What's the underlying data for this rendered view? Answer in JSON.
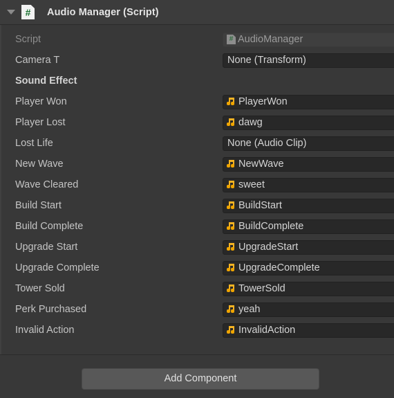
{
  "component": {
    "title": "Audio Manager (Script)",
    "foldout_icon": "chevron-down-icon",
    "script_icon": "script-file-icon",
    "script_icon_glyph": "#"
  },
  "fields": [
    {
      "label": "Script",
      "value": "AudioManager",
      "icon": "script-file-icon",
      "icon_glyph": "#",
      "disabled": true
    },
    {
      "label": "Camera T",
      "value": "None (Transform)",
      "icon": null,
      "disabled": false
    }
  ],
  "sections": [
    {
      "header": "Sound Effect",
      "fields": [
        {
          "label": "Player Won",
          "value": "PlayerWon",
          "icon": "audio-clip-icon"
        },
        {
          "label": "Player Lost",
          "value": "dawg",
          "icon": "audio-clip-icon"
        },
        {
          "label": "Lost Life",
          "value": "None (Audio Clip)",
          "icon": null
        },
        {
          "label": "New Wave",
          "value": "NewWave",
          "icon": "audio-clip-icon"
        },
        {
          "label": "Wave Cleared",
          "value": "sweet",
          "icon": "audio-clip-icon"
        },
        {
          "label": "Build Start",
          "value": "BuildStart",
          "icon": "audio-clip-icon"
        },
        {
          "label": "Build Complete",
          "value": "BuildComplete",
          "icon": "audio-clip-icon"
        },
        {
          "label": "Upgrade Start",
          "value": "UpgradeStart",
          "icon": "audio-clip-icon"
        },
        {
          "label": "Upgrade Complete",
          "value": "UpgradeComplete",
          "icon": "audio-clip-icon"
        },
        {
          "label": "Tower Sold",
          "value": "TowerSold",
          "icon": "audio-clip-icon"
        },
        {
          "label": "Perk Purchased",
          "value": "yeah",
          "icon": "audio-clip-icon"
        },
        {
          "label": "Invalid Action",
          "value": "InvalidAction",
          "icon": "audio-clip-icon"
        }
      ]
    }
  ],
  "footer": {
    "add_component_label": "Add Component"
  },
  "colors": {
    "panel_bg": "#383838",
    "header_bg": "#3c3c3c",
    "field_bg": "#282828",
    "field_bg_disabled": "#3f3f3f",
    "label_text": "#c4c4c4",
    "label_text_disabled": "#8c8c8c",
    "value_text": "#d4d4d4",
    "audio_icon": "#f4b323",
    "script_icon_green": "#17702f",
    "button_bg": "#585858"
  }
}
